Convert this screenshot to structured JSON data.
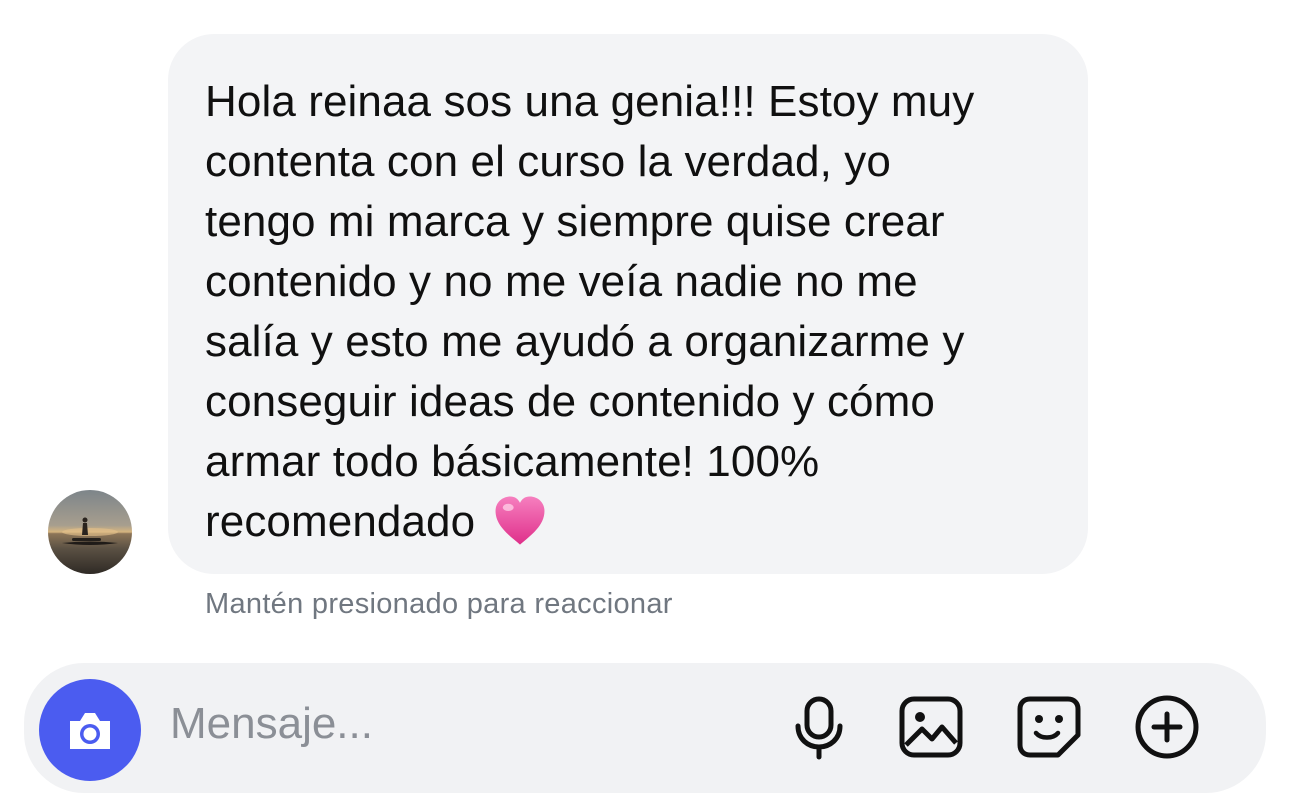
{
  "conversation": {
    "message": {
      "text": "Hola reinaa sos una genia!!! Estoy muy\ncontenta con el curso la verdad, yo\ntengo mi marca y siempre quise crear\ncontenido y no me veía nadie no me\nsalía y esto me ayudó a organizarme y\nconseguir ideas de contenido y cómo\narmar todo básicamente! 100%\nrecomendado",
      "emoji": "pink-heart-emoji"
    },
    "hint": "Mantén presionado para reaccionar"
  },
  "composer": {
    "placeholder": "Mensaje...",
    "icons": [
      "camera-icon",
      "microphone-icon",
      "gallery-icon",
      "sticker-icon",
      "plus-icon"
    ],
    "accent_color": "#4b5cf0"
  },
  "colors": {
    "bubble": "#f3f4f6",
    "hint_text": "#707780",
    "heart": "#e9488f"
  }
}
